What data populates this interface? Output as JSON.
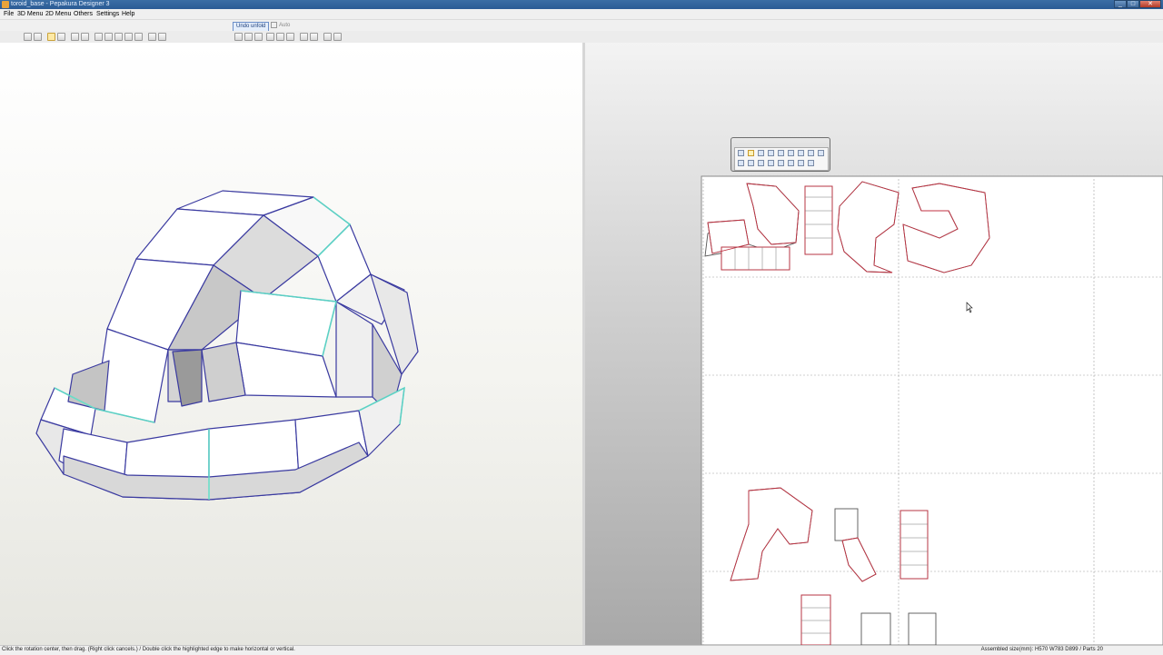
{
  "window": {
    "title": "toroid_base - Pepakura Designer 3"
  },
  "menubar": {
    "items": [
      "File",
      "3D Menu",
      "2D Menu",
      "Others",
      "Settings",
      "Help"
    ]
  },
  "toolbar": {
    "undo_unfold_label": "Undo unfold",
    "auto_label": "Auto",
    "icons": [
      "open-icon",
      "save-icon",
      "rotate-icon",
      "move-icon",
      "zoom-icon",
      "fit-icon",
      "edge-icon",
      "join-icon",
      "split-icon",
      "select-icon",
      "view-icon",
      "box-icon",
      "box-icon"
    ],
    "tools2d": [
      "align-left-icon",
      "align-center-icon",
      "align-right-icon",
      "align-top-icon",
      "align-middle-icon",
      "align-bottom-icon",
      "rotate-left-icon",
      "rotate-right-icon",
      "grid-icon",
      "grid-icon"
    ]
  },
  "palette2d": {
    "row1": [
      "zoom-icon",
      "select-icon",
      "move-icon",
      "flip-icon",
      "join-icon",
      "edge-icon",
      "text-icon",
      "image-icon",
      "undo-icon"
    ],
    "row2": [
      "rotate-icon",
      "scale-icon",
      "align-icon",
      "distribute-icon",
      "group-icon",
      "layer-icon",
      "settings-icon",
      "menu-icon"
    ]
  },
  "status": {
    "hint": "Click the rotation center, then drag. (Right click cancels.) / Double click the highlighted edge to make horizontal or vertical.",
    "assembled": "Assembled size(mm): H570 W783 D899 / Parts 20"
  },
  "colors": {
    "titlebar": "#2f6199",
    "mesh_edge": "#3a3aa0",
    "cut_line": "#c03040",
    "fold_glow": "#5fe0c8"
  }
}
